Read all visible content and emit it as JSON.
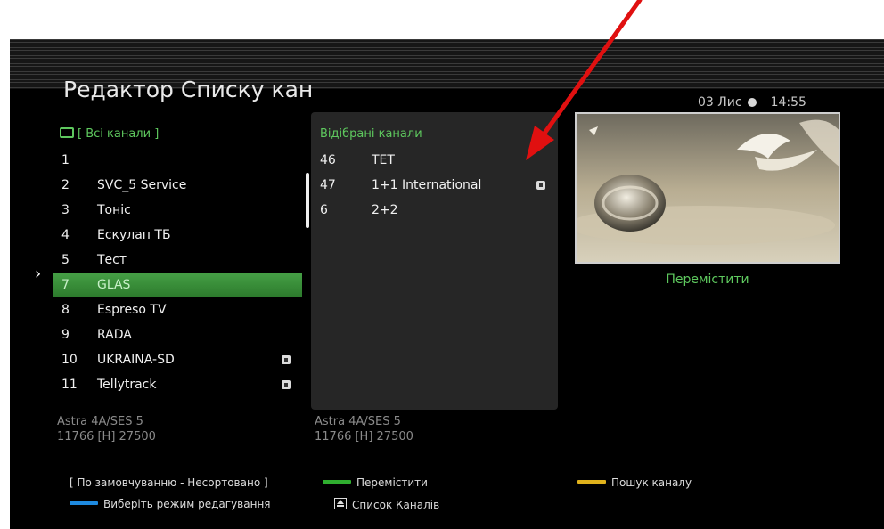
{
  "header": {
    "title": "Редактор Списку кан",
    "date": "03 Лис",
    "time": "14:55"
  },
  "left_panel": {
    "header": "[ Всі канали ]",
    "items": [
      {
        "num": "1",
        "name": "",
        "badge": false
      },
      {
        "num": "2",
        "name": "SVC_5 Service",
        "badge": false
      },
      {
        "num": "3",
        "name": "Тоніс",
        "badge": false
      },
      {
        "num": "4",
        "name": "Ескулап ТБ",
        "badge": false
      },
      {
        "num": "5",
        "name": "Тест",
        "badge": false
      },
      {
        "num": "7",
        "name": "GLAS",
        "badge": false,
        "selected": true
      },
      {
        "num": "8",
        "name": "Espreso TV",
        "badge": false
      },
      {
        "num": "9",
        "name": "RADA",
        "badge": false
      },
      {
        "num": "10",
        "name": "UKRAINA-SD",
        "badge": true
      },
      {
        "num": "11",
        "name": "Tellytrack",
        "badge": true
      }
    ],
    "sat_name": "Astra 4A/SES 5",
    "sat_freq": "11766 [H] 27500"
  },
  "middle_panel": {
    "header": "Відібрані канали",
    "items": [
      {
        "num": "46",
        "name": "TET",
        "badge": false
      },
      {
        "num": "47",
        "name": "1+1 International",
        "badge": true
      },
      {
        "num": "6",
        "name": "2+2",
        "badge": false
      }
    ],
    "sat_name": "Astra 4A/SES 5",
    "sat_freq": "11766 [H] 27500"
  },
  "preview": {
    "action_label": "Перемістити"
  },
  "legend": {
    "sort_label": "[ По замовчуванню - Несортовано ]",
    "green_label": "Перемістити",
    "yellow_label": "Пошук каналу",
    "blue_label": "Виберіть режим редагування",
    "eject_label": "Список Каналів"
  },
  "colors": {
    "green": "#2fae2f",
    "yellow": "#e0b21c",
    "blue": "#1e8ae0",
    "arrow": "#e01010"
  }
}
